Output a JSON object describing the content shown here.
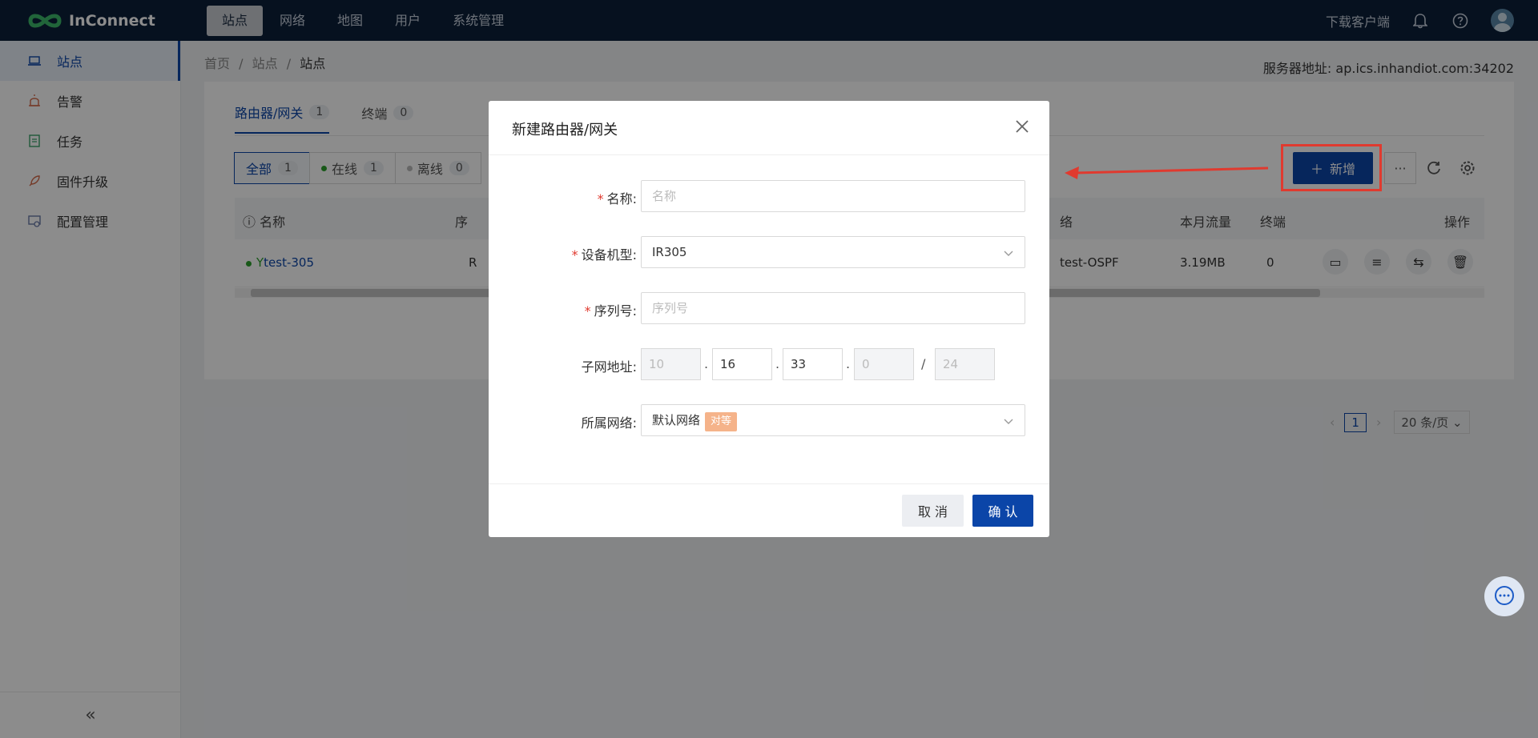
{
  "app": {
    "name": "InConnect"
  },
  "topnav": {
    "items": [
      "站点",
      "网络",
      "地图",
      "用户",
      "系统管理"
    ],
    "active": 0
  },
  "topright": {
    "download": "下载客户端"
  },
  "sidebar": {
    "items": [
      "站点",
      "告警",
      "任务",
      "固件升级",
      "配置管理"
    ],
    "active": 0,
    "collapse": "«"
  },
  "breadcrumb": {
    "items": [
      "首页",
      "/",
      "站点",
      "/",
      "站点"
    ]
  },
  "server": {
    "label": "服务器地址: ap.ics.inhandiot.com:34202"
  },
  "tabs": [
    {
      "label": "路由器/网关",
      "count": "1"
    },
    {
      "label": "终端",
      "count": "0"
    }
  ],
  "filters": [
    {
      "label": "全部",
      "count": "1"
    },
    {
      "label": "在线",
      "count": "1"
    },
    {
      "label": "离线",
      "count": "0"
    }
  ],
  "table": {
    "headers": {
      "name": "名称",
      "col2": "序",
      "col_net": "络",
      "traffic": "本月流量",
      "terminal": "终端",
      "ops": "操作"
    },
    "rows": [
      {
        "name": "test-305",
        "col2": "R",
        "net": "test-OSPF",
        "traffic": "3.19MB",
        "terminal": "0"
      }
    ]
  },
  "actions": {
    "add": "新增",
    "more": "···"
  },
  "pagination": {
    "current": "1",
    "page_size": "20 条/页"
  },
  "modal": {
    "title": "新建路由器/网关",
    "fields": {
      "name": {
        "label": "名称:",
        "placeholder": "名称",
        "required": true
      },
      "model": {
        "label": "设备机型:",
        "value": "IR305",
        "required": true
      },
      "serial": {
        "label": "序列号:",
        "placeholder": "序列号",
        "required": true
      },
      "subnet": {
        "label": "子网地址:",
        "octets": [
          "10",
          "16",
          "33",
          "0"
        ],
        "mask": "24"
      },
      "network": {
        "label": "所属网络:",
        "value": "默认网络",
        "tag": "对等"
      }
    },
    "cancel": "取 消",
    "confirm": "确 认"
  },
  "colors": {
    "primary": "#0b45a8",
    "topbar": "#0b1f3a",
    "highlight": "#e03a2f",
    "tag": "#f5b38a",
    "online": "#2ca02c"
  }
}
